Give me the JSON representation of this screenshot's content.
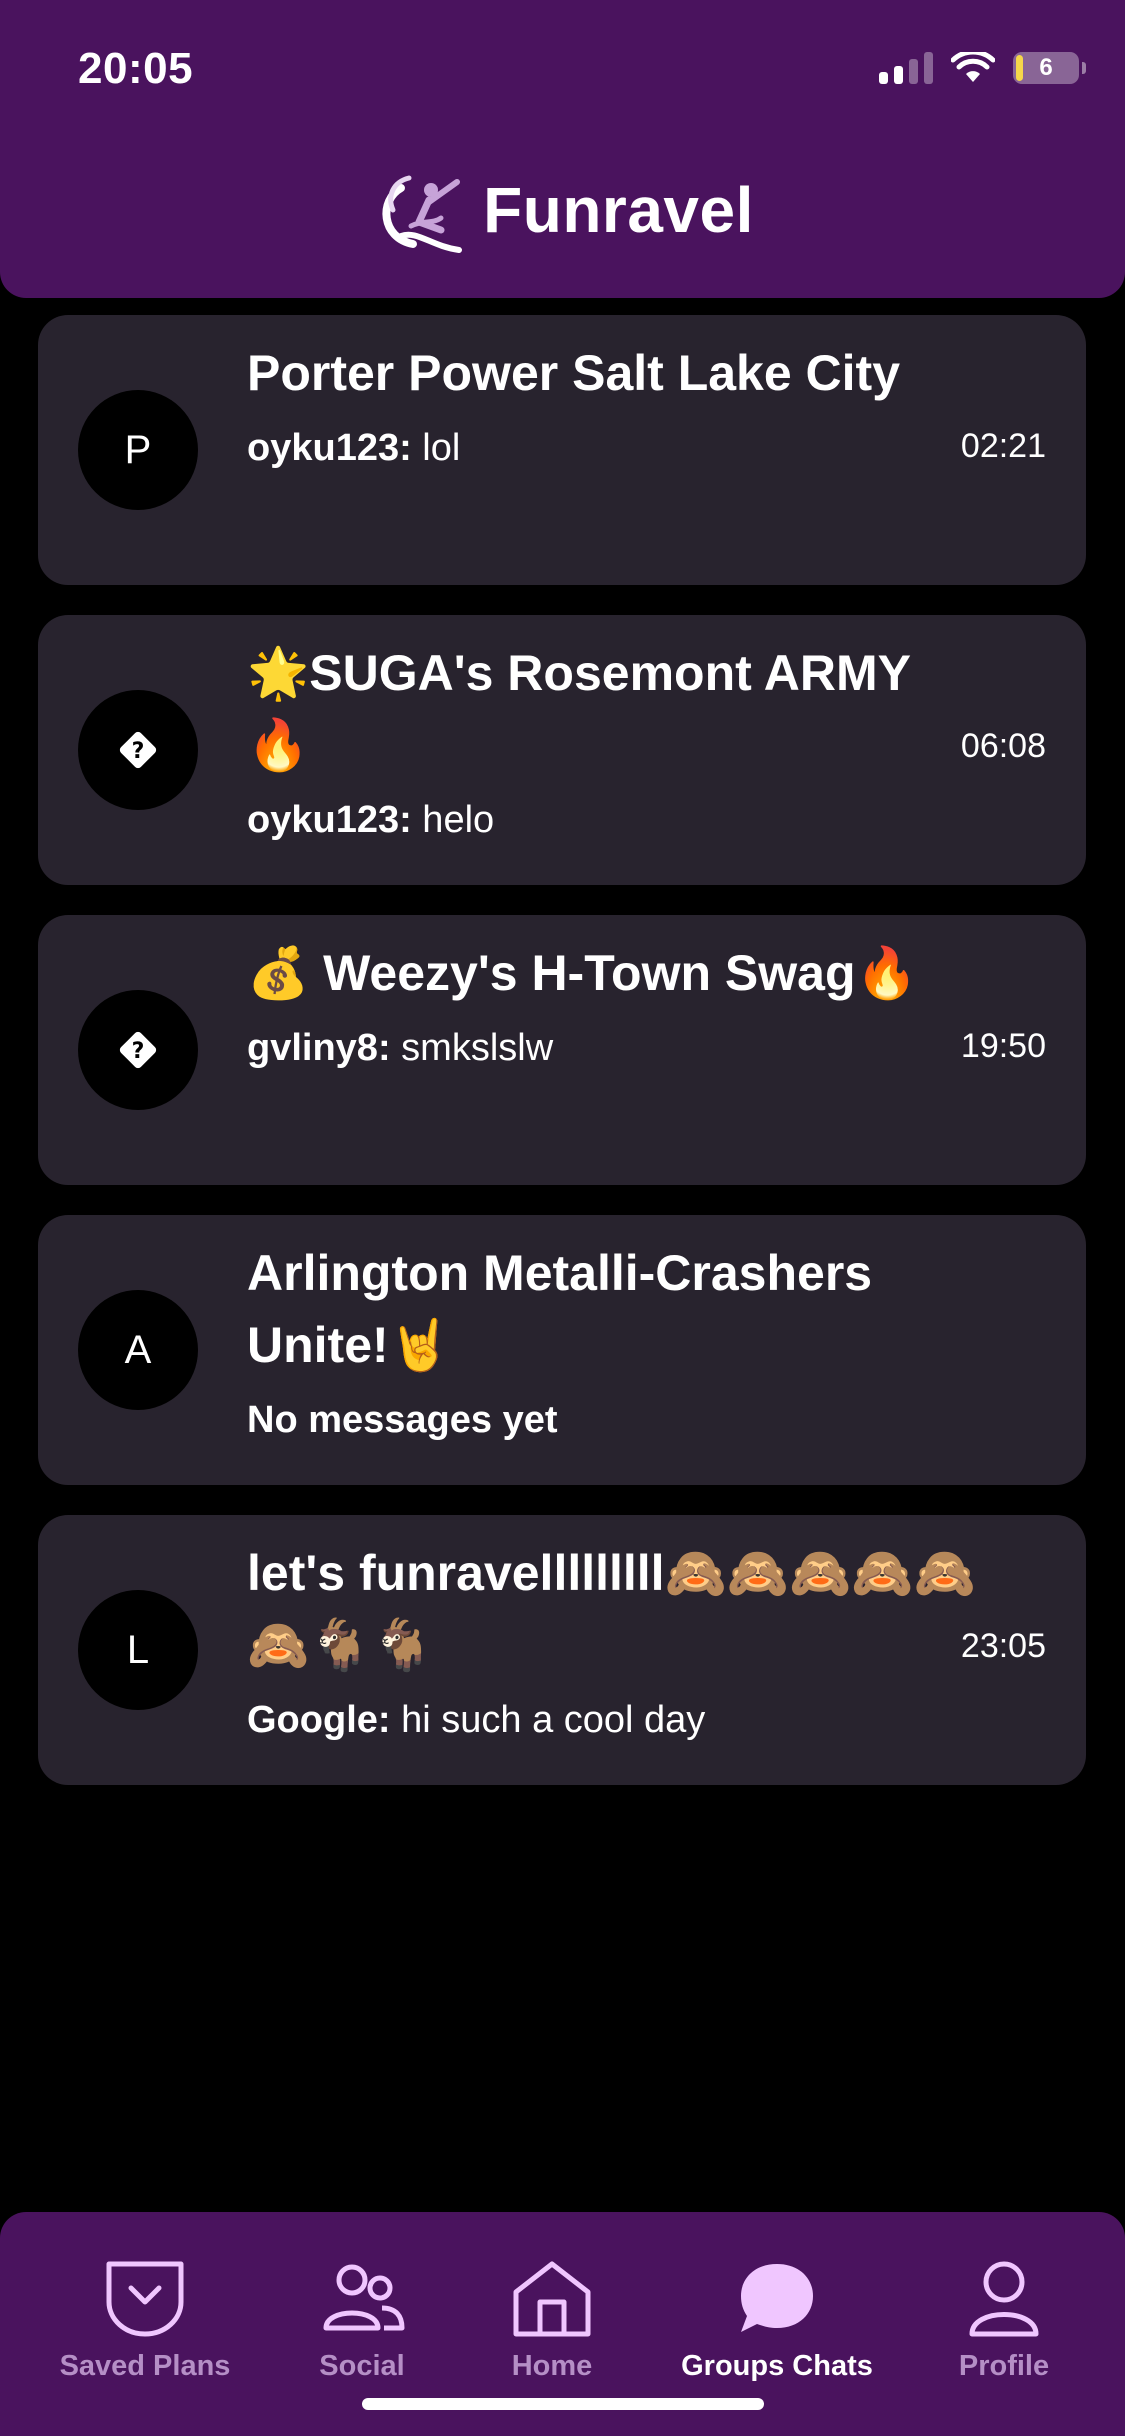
{
  "status_bar": {
    "time": "20:05",
    "battery": "6"
  },
  "app": {
    "title": "Funravel"
  },
  "chats": [
    {
      "avatar": "P",
      "title": "Porter Power Salt Lake City",
      "sender": "oyku123:",
      "message": " lol",
      "time": "02:21"
    },
    {
      "avatar": "?",
      "title": "🌟SUGA's Rosemont ARMY 🔥",
      "sender": "oyku123:",
      "message": " helo",
      "time": "06:08"
    },
    {
      "avatar": "?",
      "title": "💰 Weezy's H-Town Swag🔥",
      "sender": "gvliny8:",
      "message": " smkslslw",
      "time": "19:50"
    },
    {
      "avatar": "A",
      "title": "Arlington Metalli-Crashers Unite!🤘",
      "sender": "No messages yet",
      "message": "",
      "time": ""
    },
    {
      "avatar": "L",
      "title": "let's funravelllllllll🙈🙈🙈🙈🙈🙈🐐🐐",
      "sender": "Google:",
      "message": " hi such a cool day",
      "time": "23:05"
    }
  ],
  "nav": {
    "saved_plans": "Saved Plans",
    "social": "Social",
    "home": "Home",
    "group_chats": "Groups Chats",
    "profile": "Profile"
  },
  "colors": {
    "header": "#4a135e",
    "card": "#28232e",
    "nav_inactive": "#b58fc6",
    "accent": "#f0c6ff"
  }
}
